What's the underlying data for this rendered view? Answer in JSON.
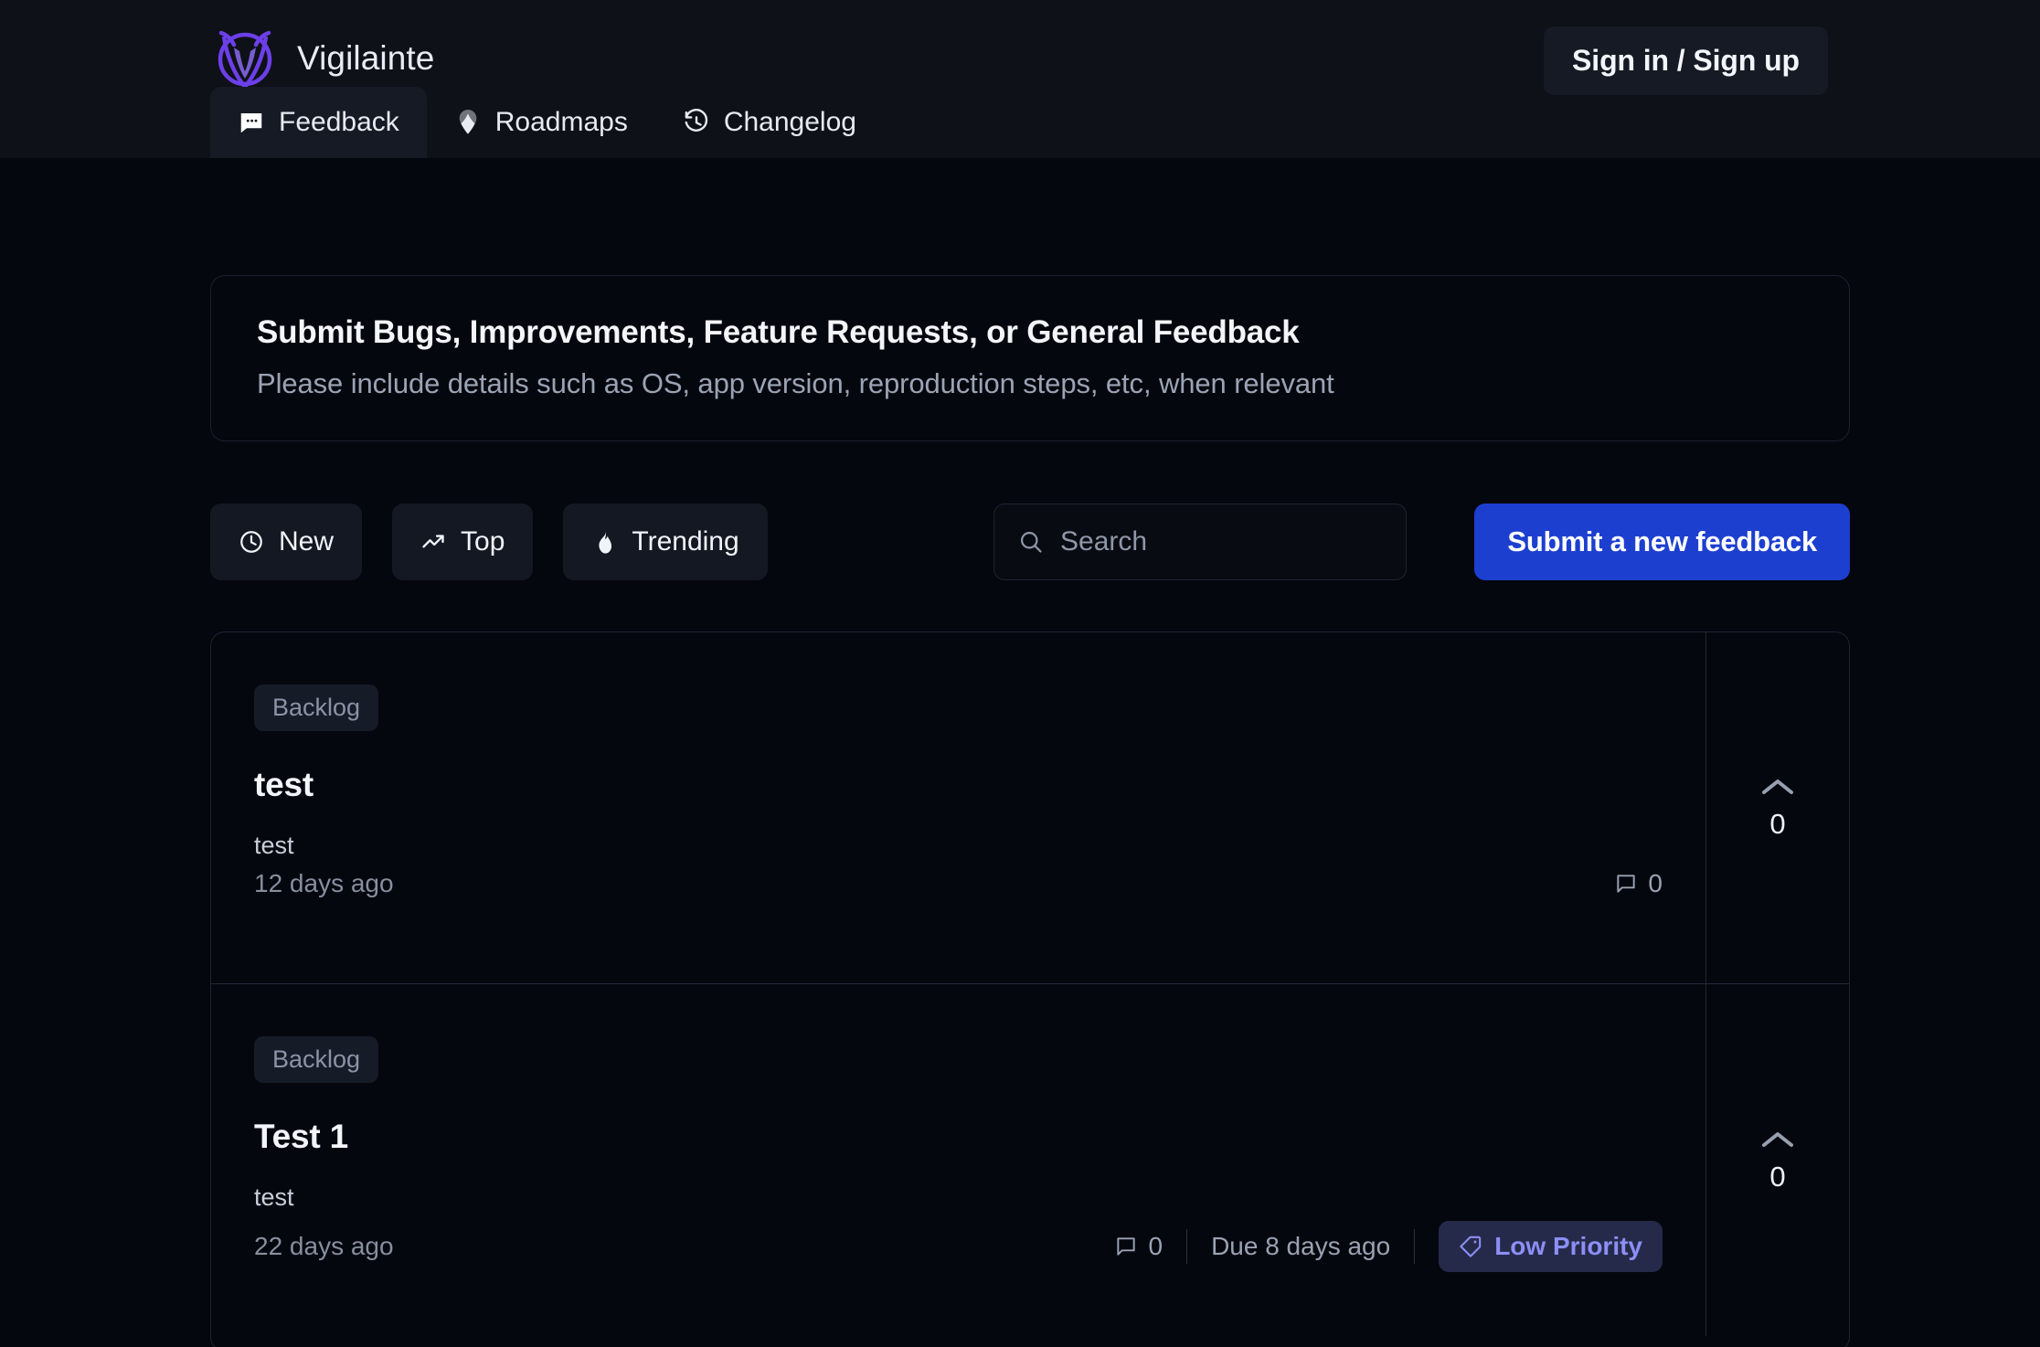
{
  "header": {
    "brand_name": "Vigilainte",
    "brand_logo_icon": "owl-v-logo",
    "signin_label": "Sign in / Sign up",
    "tabs": [
      {
        "label": "Feedback",
        "icon": "message-square-icon",
        "active": true
      },
      {
        "label": "Roadmaps",
        "icon": "map-pin-icon",
        "active": false
      },
      {
        "label": "Changelog",
        "icon": "history-clock-icon",
        "active": false
      }
    ]
  },
  "hero": {
    "title": "Submit Bugs, Improvements, Feature Requests, or General Feedback",
    "subtitle": "Please include details such as OS, app version, reproduction steps, etc, when relevant"
  },
  "controls": {
    "filters": [
      {
        "label": "New",
        "icon": "clock-icon"
      },
      {
        "label": "Top",
        "icon": "trending-up-icon"
      },
      {
        "label": "Trending",
        "icon": "flame-icon"
      }
    ],
    "search": {
      "icon": "search-icon",
      "value": "",
      "placeholder": "Search"
    },
    "submit_label": "Submit a new feedback"
  },
  "feedback": [
    {
      "status": "Backlog",
      "title": "test",
      "description": "test",
      "time": "12 days ago",
      "comments": "0",
      "comment_icon": "comment-icon",
      "due": null,
      "priority": null,
      "votes": "0",
      "vote_icon": "chevron-up-icon"
    },
    {
      "status": "Backlog",
      "title": "Test 1",
      "description": "test",
      "time": "22 days ago",
      "comments": "0",
      "comment_icon": "comment-icon",
      "due": "Due 8 days ago",
      "priority": "Low Priority",
      "priority_icon": "tag-icon",
      "votes": "0",
      "vote_icon": "chevron-up-icon"
    }
  ],
  "colors": {
    "page_bg": "#05070e",
    "header_bg": "#0e1118",
    "accent_blue": "#1d3fd0",
    "brand_purple": "#6c3fe8",
    "priority_text": "#8b8ff5",
    "priority_bg": "#262a4a"
  }
}
